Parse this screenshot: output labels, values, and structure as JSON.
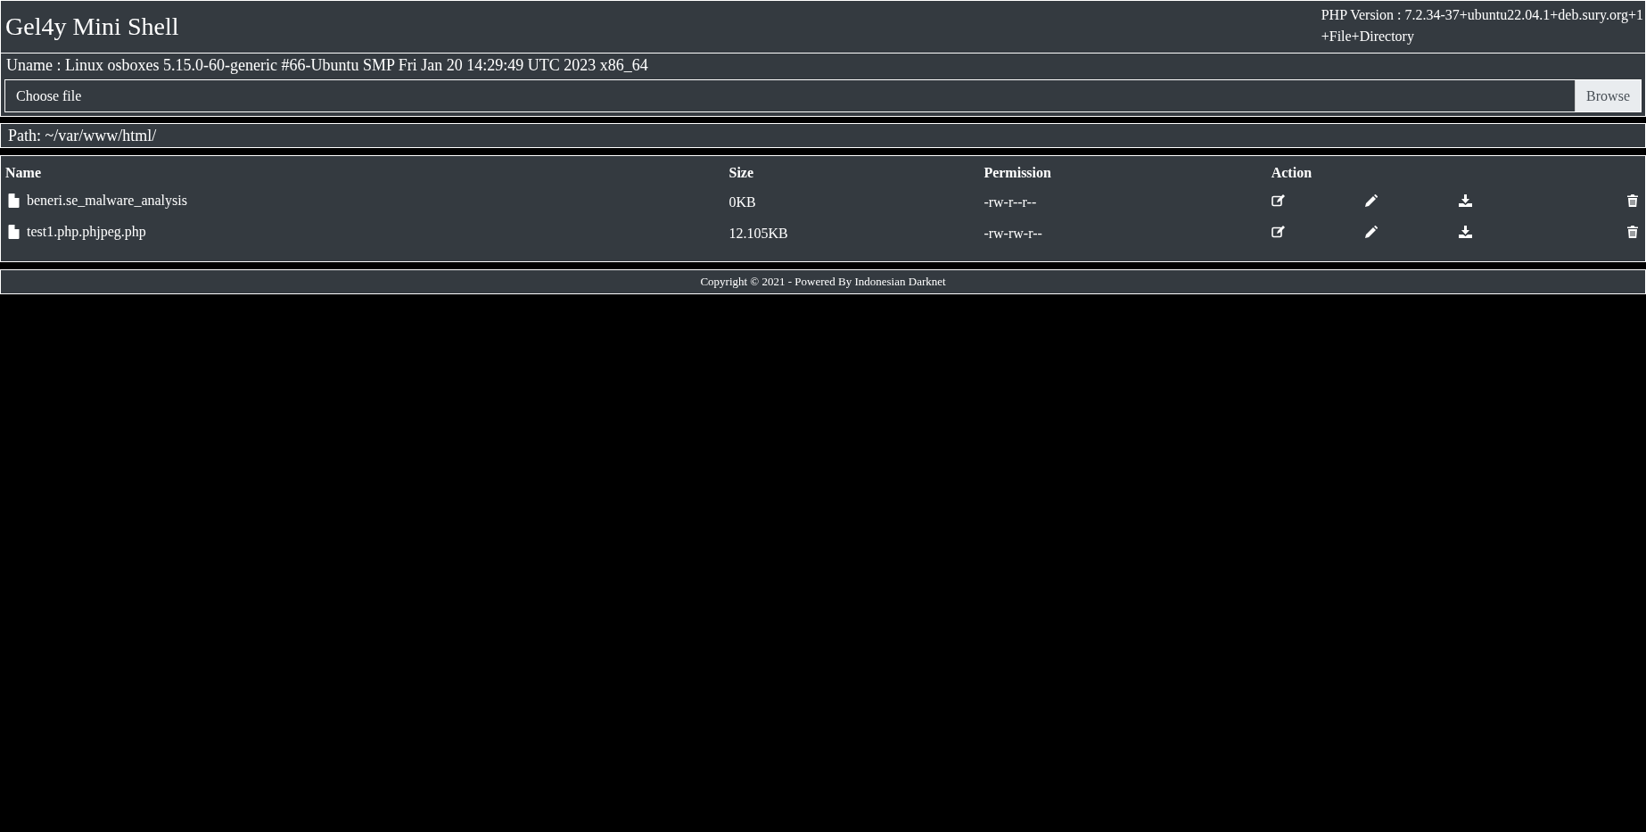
{
  "header": {
    "title": "Gel4y Mini Shell",
    "php_version": "PHP Version : 7.2.34-37+ubuntu22.04.1+deb.sury.org+1",
    "link": "+File+Directory"
  },
  "uname": "Uname : Linux osboxes 5.15.0-60-generic #66-Ubuntu SMP Fri Jan 20 14:29:49 UTC 2023 x86_64",
  "upload": {
    "placeholder": "Choose file",
    "button": "Browse"
  },
  "path": "Path: ~/var/www/html/",
  "table": {
    "columns": [
      "Name",
      "Size",
      "Permission",
      "Action"
    ],
    "rows": [
      {
        "name": "beneri.se_malware_analysis",
        "size": "0KB",
        "permission": "-rw-r--r--"
      },
      {
        "name": "test1.php.phjpeg.php",
        "size": "12.105KB",
        "permission": "-rw-rw-r--"
      }
    ]
  },
  "footer": "Copyright © 2021 - Powered By Indonesian Darknet"
}
